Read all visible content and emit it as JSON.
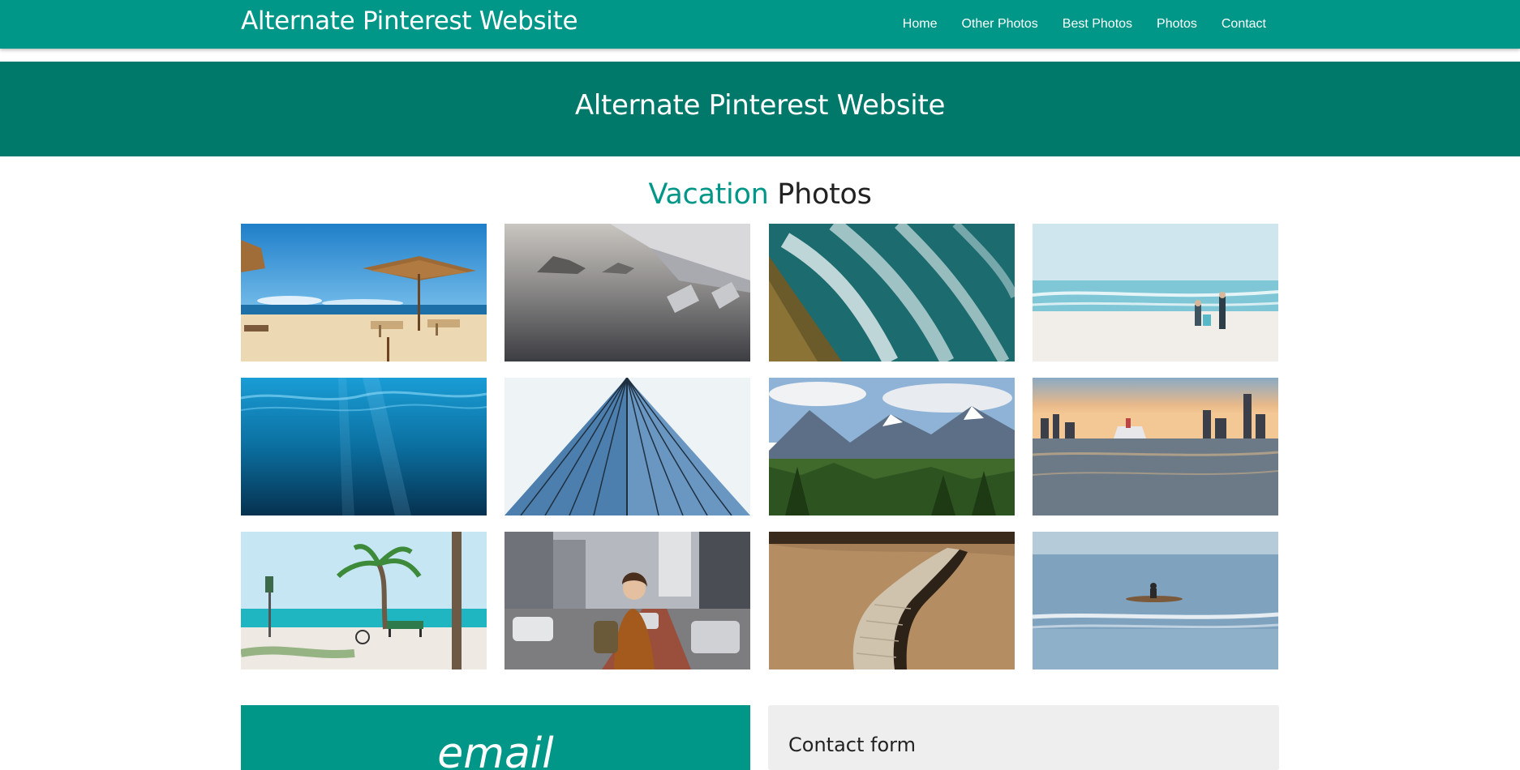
{
  "header": {
    "brand": "Alternate Pinterest Website",
    "nav": [
      {
        "label": "Home"
      },
      {
        "label": "Other Photos"
      },
      {
        "label": "Best Photos"
      },
      {
        "label": "Photos"
      },
      {
        "label": "Contact"
      }
    ]
  },
  "hero": {
    "title": "Alternate Pinterest Website"
  },
  "gallery": {
    "title_accent": "Vacation",
    "title_rest": "Photos",
    "photos": [
      {
        "subject": "beach-umbrellas"
      },
      {
        "subject": "airplane-wing"
      },
      {
        "subject": "aerial-waves"
      },
      {
        "subject": "beach-couple"
      },
      {
        "subject": "underwater"
      },
      {
        "subject": "glass-building"
      },
      {
        "subject": "mountain-valley"
      },
      {
        "subject": "city-skyline-ship"
      },
      {
        "subject": "palm-beach-bench"
      },
      {
        "subject": "woman-city-street"
      },
      {
        "subject": "boardwalk-field"
      },
      {
        "subject": "kayak-sea"
      }
    ]
  },
  "email_card": {
    "label": "email"
  },
  "contact": {
    "title": "Contact form"
  },
  "colors": {
    "primary": "#009688",
    "primary_dark": "#00796b",
    "contact_bg": "#eeeeee"
  }
}
